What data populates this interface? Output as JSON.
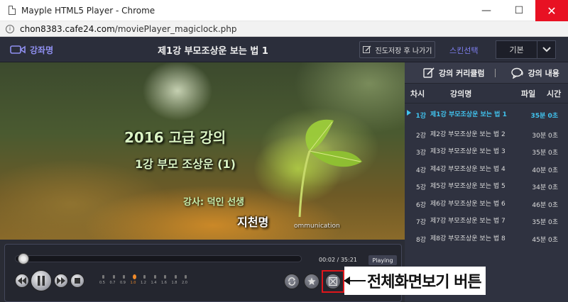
{
  "window": {
    "title": "Mayple HTML5 Player - Chrome",
    "minimize": "—",
    "maximize": "☐",
    "close": "✕"
  },
  "address": {
    "host": "chon8383.cafe24.com",
    "path": "/moviePlayer_magiclock.php"
  },
  "header": {
    "course_label": "강좌명",
    "lecture_title": "제1강 부모조상운 보는 법 1",
    "save_exit_label": "진도저장 후 나가기",
    "skin_label": "스킨선택",
    "skin_value": "기본"
  },
  "video": {
    "line1": "2016 고급 강의",
    "line2": "1강 부모 조상운 (1)",
    "line3": "강사: 덕인 선생",
    "line4": "지천명",
    "watermark": "ommunication"
  },
  "panel": {
    "tab_curriculum": "강의 커리큘럼",
    "tab_content": "강의 내용",
    "col_num": "차시",
    "col_name": "강의명",
    "col_file": "파일",
    "col_time": "시간",
    "items": [
      {
        "num": "1강",
        "name": "제1강 부모조상운 보는 법 1",
        "time": "35분 0초"
      },
      {
        "num": "2강",
        "name": "제2강 부모조상운 보는 법 2",
        "time": "30분 0초"
      },
      {
        "num": "3강",
        "name": "제3강 부모조상운 보는 법 3",
        "time": "35분 0초"
      },
      {
        "num": "4강",
        "name": "제4강 부모조상운 보는 법 4",
        "time": "40분 0초"
      },
      {
        "num": "5강",
        "name": "제5강 부모조상운 보는 법 5",
        "time": "34분 0초"
      },
      {
        "num": "6강",
        "name": "제6강 부모조상운 보는 법 6",
        "time": "46분 0초"
      },
      {
        "num": "7강",
        "name": "제7강 부모조상운 보는 법 7",
        "time": "35분 0초"
      },
      {
        "num": "8강",
        "name": "제8강 부모조상운 보는 법 8",
        "time": "45분 0초"
      }
    ]
  },
  "player": {
    "timecode": "00:02 / 35:21",
    "status": "Playing",
    "speeds": [
      "0.5",
      "0.7",
      "0.9",
      "1.0",
      "1.2",
      "1.4",
      "1.6",
      "1.8",
      "2.0"
    ],
    "active_speed": "1.0",
    "progress": 0.001
  },
  "annotation": {
    "text": "전체화면보기 버튼"
  },
  "colors": {
    "accent": "#41c3ee",
    "highlight_box": "#e0161b",
    "speed_active": "#f08a2a"
  }
}
